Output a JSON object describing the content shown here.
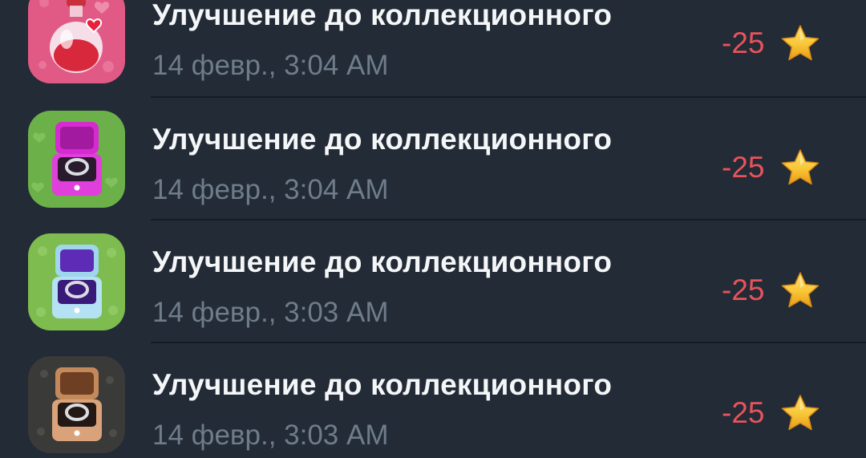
{
  "colors": {
    "background": "#222b36",
    "title": "#f4f6f8",
    "date": "#6f7c89",
    "amount": "#e8535b",
    "star": "#f7c33a"
  },
  "transactions": [
    {
      "icon": "love-potion-gift-icon",
      "title": "Улучшение до коллекционного",
      "date": "14 февр., 3:04 AM",
      "amount": "-25",
      "currency_icon": "star-icon"
    },
    {
      "icon": "magenta-ring-box-gift-icon",
      "title": "Улучшение до коллекционного",
      "date": "14 февр., 3:04 AM",
      "amount": "-25",
      "currency_icon": "star-icon"
    },
    {
      "icon": "blue-ring-box-gift-icon",
      "title": "Улучшение до коллекционного",
      "date": "14 февр., 3:03 AM",
      "amount": "-25",
      "currency_icon": "star-icon"
    },
    {
      "icon": "bronze-ring-box-gift-icon",
      "title": "Улучшение до коллекционного",
      "date": "14 февр., 3:03 AM",
      "amount": "-25",
      "currency_icon": "star-icon"
    }
  ]
}
